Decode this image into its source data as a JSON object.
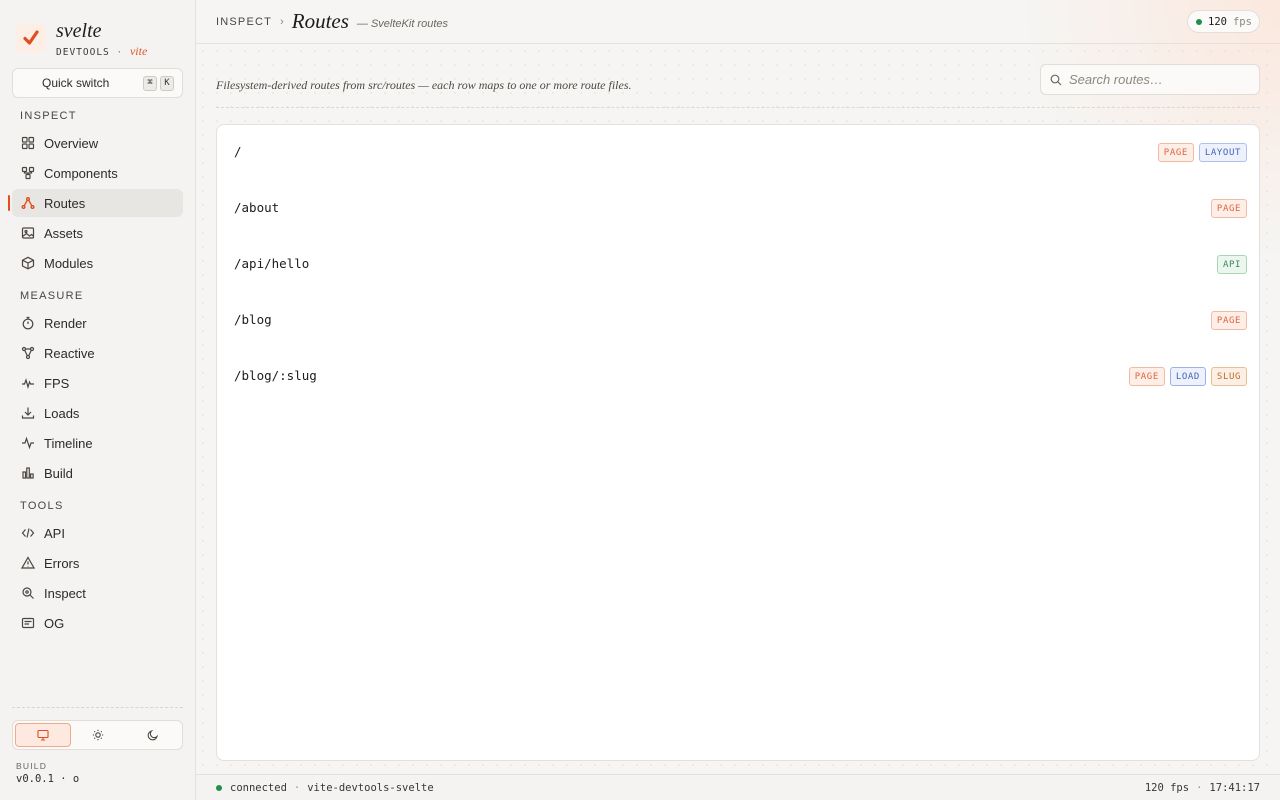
{
  "brand": {
    "name": "svelte",
    "sub": "DEVTOOLS",
    "sep": "·",
    "variant": "vite",
    "accent": "#e04e21"
  },
  "quick_switch": {
    "label": "Quick switch",
    "keys": [
      "⌘",
      "K"
    ]
  },
  "sidebar": {
    "sections": [
      {
        "label": "INSPECT",
        "items": [
          {
            "label": "Overview",
            "icon": "grid-icon"
          },
          {
            "label": "Components",
            "icon": "components-icon"
          },
          {
            "label": "Routes",
            "icon": "routes-icon",
            "active": true
          },
          {
            "label": "Assets",
            "icon": "image-icon"
          },
          {
            "label": "Modules",
            "icon": "cube-icon"
          }
        ]
      },
      {
        "label": "MEASURE",
        "items": [
          {
            "label": "Render",
            "icon": "stopwatch-icon"
          },
          {
            "label": "Reactive",
            "icon": "graph-icon"
          },
          {
            "label": "FPS",
            "icon": "pulse-icon"
          },
          {
            "label": "Loads",
            "icon": "download-icon"
          },
          {
            "label": "Timeline",
            "icon": "activity-icon"
          },
          {
            "label": "Build",
            "icon": "bar-chart-icon"
          }
        ]
      },
      {
        "label": "TOOLS",
        "items": [
          {
            "label": "API",
            "icon": "code-icon"
          },
          {
            "label": "Errors",
            "icon": "warning-icon"
          },
          {
            "label": "Inspect",
            "icon": "inspect-icon"
          },
          {
            "label": "OG",
            "icon": "card-icon"
          }
        ]
      }
    ]
  },
  "theme": {
    "options": [
      "monitor-icon",
      "sun-icon",
      "moon-icon"
    ],
    "selected": "monitor-icon"
  },
  "build": {
    "label": "BUILD",
    "version": "v0.0.1 · o"
  },
  "header": {
    "breadcrumb_root": "INSPECT",
    "breadcrumb_sep": "›",
    "title": "Routes",
    "subtitle": "— SvelteKit routes",
    "fps_value": "120",
    "fps_unit": "fps"
  },
  "description": "Filesystem-derived routes from src/routes — each row maps to one or more route files.",
  "search": {
    "placeholder": "Search routes…",
    "value": ""
  },
  "routes": [
    {
      "path": "/",
      "badges": [
        {
          "label": "PAGE",
          "kind": "page"
        },
        {
          "label": "LAYOUT",
          "kind": "layout"
        }
      ]
    },
    {
      "path": "/about",
      "badges": [
        {
          "label": "PAGE",
          "kind": "page"
        }
      ]
    },
    {
      "path": "/api/hello",
      "badges": [
        {
          "label": "API",
          "kind": "api"
        }
      ]
    },
    {
      "path": "/blog",
      "badges": [
        {
          "label": "PAGE",
          "kind": "page"
        }
      ]
    },
    {
      "path": "/blog/:slug",
      "badges": [
        {
          "label": "PAGE",
          "kind": "page"
        },
        {
          "label": "LOAD",
          "kind": "load"
        },
        {
          "label": "SLUG",
          "kind": "slug"
        }
      ]
    }
  ],
  "status": {
    "connection": "connected",
    "sep": "·",
    "app": "vite-devtools-svelte",
    "fps": "120 fps",
    "time": "17:41:17"
  }
}
